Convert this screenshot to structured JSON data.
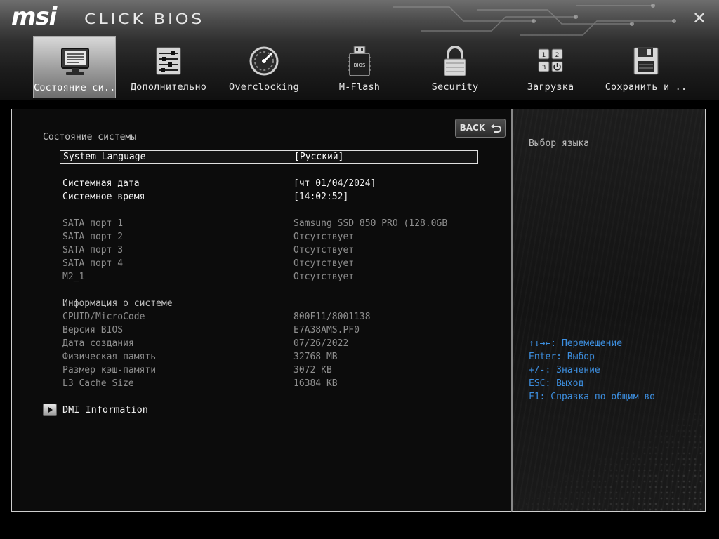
{
  "header": {
    "brand": "msi",
    "product": "CLICK BIOS",
    "close_symbol": "✕"
  },
  "tabs": [
    {
      "label": "Состояние си..",
      "icon": "monitor-icon",
      "active": true
    },
    {
      "label": "Дополнительно",
      "icon": "sliders-icon",
      "active": false
    },
    {
      "label": "Overclocking",
      "icon": "gauge-icon",
      "active": false
    },
    {
      "label": "M-Flash",
      "icon": "usb-bios-icon",
      "active": false
    },
    {
      "label": "Security",
      "icon": "padlock-icon",
      "active": false
    },
    {
      "label": "Загрузка",
      "icon": "boot-icon",
      "active": false
    },
    {
      "label": "Сохранить и ..",
      "icon": "floppy-icon",
      "active": false
    }
  ],
  "main": {
    "section_title": "Состояние системы",
    "back_label": "BACK",
    "rows": {
      "language": {
        "label": "System Language",
        "value": "[Русский]"
      },
      "date": {
        "label": "Системная дата",
        "value": "[чт 01/04/2024]"
      },
      "time": {
        "label": "Системное время",
        "value": "[14:02:52]"
      },
      "sata1": {
        "label": "SATA порт 1",
        "value": "Samsung SSD 850 PRO  (128.0GB"
      },
      "sata2": {
        "label": "SATA порт 2",
        "value": "Отсутствует"
      },
      "sata3": {
        "label": "SATA порт 3",
        "value": "Отсутствует"
      },
      "sata4": {
        "label": "SATA порт 4",
        "value": "Отсутствует"
      },
      "m2": {
        "label": "M2_1",
        "value": "Отсутствует"
      },
      "sysinfo": {
        "label": "Информация о системе"
      },
      "cpuid": {
        "label": "CPUID/MicroCode",
        "value": "800F11/8001138"
      },
      "bios": {
        "label": "Версия BIOS",
        "value": "E7A38AMS.PF0"
      },
      "builddate": {
        "label": "Дата создания",
        "value": "07/26/2022"
      },
      "memory": {
        "label": "Физическая память",
        "value": "32768 MB"
      },
      "cache": {
        "label": "Размер кэш-памяти",
        "value": "3072 KB"
      },
      "l3": {
        "label": "L3 Cache Size",
        "value": "16384 KB"
      }
    },
    "dmi_label": "DMI Information"
  },
  "help": {
    "description": "Выбор языка",
    "keys": [
      "↑↓→←: Перемещение",
      "Enter: Выбор",
      "+/-: Значение",
      "ESC: Выход",
      "F1: Справка по общим во"
    ]
  },
  "colors": {
    "accent_help": "#3d8fe0",
    "panel_border": "#cfcfcf",
    "text_dim": "#8e8e8e"
  }
}
